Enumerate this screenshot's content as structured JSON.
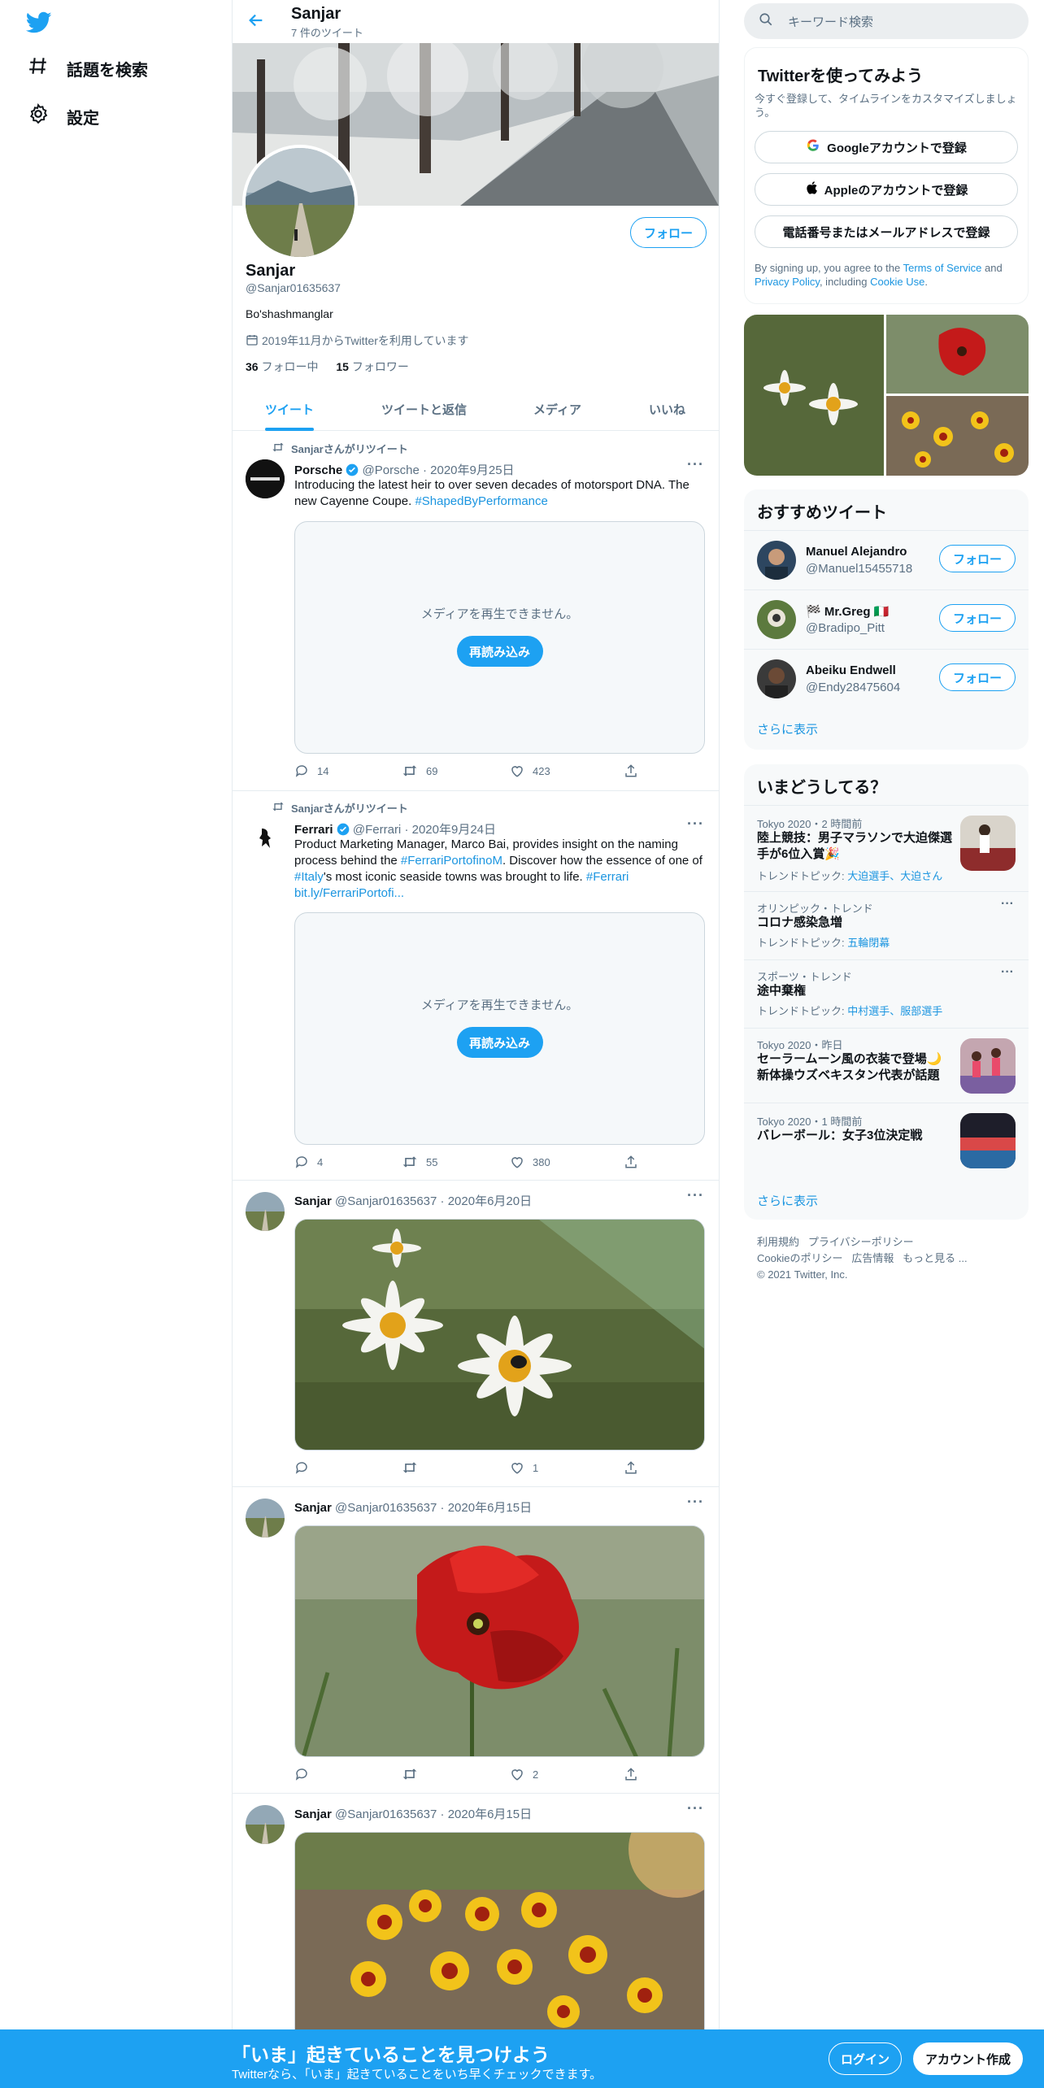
{
  "nav": {
    "explore": "話題を検索",
    "settings": "設定"
  },
  "header": {
    "name": "Sanjar",
    "tweet_count": "7 件のツイート"
  },
  "profile": {
    "follow": "フォロー",
    "name": "Sanjar",
    "handle": "@Sanjar01635637",
    "bio": "Bo'shashmanglar",
    "joined": "2019年11月からTwitterを利用しています",
    "following_count": "36",
    "following_label": "フォロー中",
    "followers_count": "15",
    "followers_label": "フォロワー"
  },
  "tabs": [
    "ツイート",
    "ツイートと返信",
    "メディア",
    "いいね"
  ],
  "tweets": [
    {
      "retweet_label": "Sanjarさんがリツイート",
      "name": "Porsche",
      "handle": "@Porsche",
      "date": "2020年9月25日",
      "text": "Introducing the latest heir to over seven decades of motorsport DNA. The new Cayenne Coupe. ",
      "hashtag": "#ShapedByPerformance",
      "media_msg": "メディアを再生できません。",
      "reload": "再読み込み",
      "replies": "14",
      "retweets": "69",
      "likes": "423"
    },
    {
      "retweet_label": "Sanjarさんがリツイート",
      "name": "Ferrari",
      "handle": "@Ferrari",
      "date": "2020年9月24日",
      "text_1": "Product Marketing Manager, Marco Bai, provides insight on the naming process behind the ",
      "link_1": "#FerrariPortofinoM",
      "text_2": ". Discover how the essence of one of ",
      "link_2": "#Italy",
      "text_3": "'s most iconic seaside towns was brought to life. ",
      "link_3": "#Ferrari",
      "link_4": "bit.ly/FerrariPortofi...",
      "media_msg": "メディアを再生できません。",
      "reload": "再読み込み",
      "replies": "4",
      "retweets": "55",
      "likes": "380"
    },
    {
      "name": "Sanjar",
      "handle": "@Sanjar01635637",
      "date": "2020年6月20日",
      "likes": "1"
    },
    {
      "name": "Sanjar",
      "handle": "@Sanjar01635637",
      "date": "2020年6月15日",
      "likes": "2"
    },
    {
      "name": "Sanjar",
      "handle": "@Sanjar01635637",
      "date": "2020年6月15日"
    }
  ],
  "sidebar": {
    "search_placeholder": "キーワード検索",
    "signup": {
      "title": "Twitterを使ってみよう",
      "subtitle": "今すぐ登録して、タイムラインをカスタマイズしましょう。",
      "google": "Googleアカウントで登録",
      "apple": "Appleのアカウントで登録",
      "phone": "電話番号またはメールアドレスで登録",
      "legal_1": "By signing up, you agree to the ",
      "terms": "Terms of Service",
      "legal_2": " and ",
      "privacy": "Privacy Policy",
      "legal_3": ", including ",
      "cookie": "Cookie Use",
      "legal_4": "."
    },
    "who_to_follow": {
      "title": "おすすめツイート",
      "follow_label": "フォロー",
      "users": [
        {
          "name": "Manuel Alejandro",
          "handle": "@Manuel15455718"
        },
        {
          "name": "🏁 Mr.Greg 🇮🇹",
          "handle": "@Bradipo_Pitt"
        },
        {
          "name": "Abeiku Endwell",
          "handle": "@Endy28475604"
        }
      ],
      "show_more": "さらに表示"
    },
    "trends": {
      "title": "いまどうしてる？",
      "items": [
        {
          "meta": "Tokyo 2020・2 時間前",
          "title": "陸上競技：男子マラソンで大迫傑選手が6位入賞🎉",
          "sub_label": "トレンドトピック: ",
          "sub_link": "大迫選手、大迫さん"
        },
        {
          "meta": "オリンピック・トレンド",
          "title": "コロナ感染急増",
          "sub_label": "トレンドトピック: ",
          "sub_link": "五輪閉幕"
        },
        {
          "meta": "スポーツ・トレンド",
          "title": "途中棄権",
          "sub_label": "トレンドトピック: ",
          "sub_link": "中村選手、服部選手"
        },
        {
          "meta": "Tokyo 2020・昨日",
          "title": "セーラームーン風の衣装で登場🌙 新体操ウズベキスタン代表が話題"
        },
        {
          "meta": "Tokyo 2020・1 時間前",
          "title": "バレーボール：女子3位決定戦"
        }
      ],
      "show_more": "さらに表示"
    },
    "footer": {
      "terms": "利用規約",
      "privacy": "プライバシーポリシー",
      "cookie": "Cookieのポリシー",
      "ads": "広告情報",
      "more": "もっと見る ...",
      "copyright": "© 2021 Twitter, Inc."
    }
  },
  "bottom_bar": {
    "title": "「いま」起きていることを見つけよう",
    "subtitle": "Twitterなら、「いま」起きていることをいち早くチェックできます。",
    "login": "ログイン",
    "signup": "アカウント作成"
  }
}
